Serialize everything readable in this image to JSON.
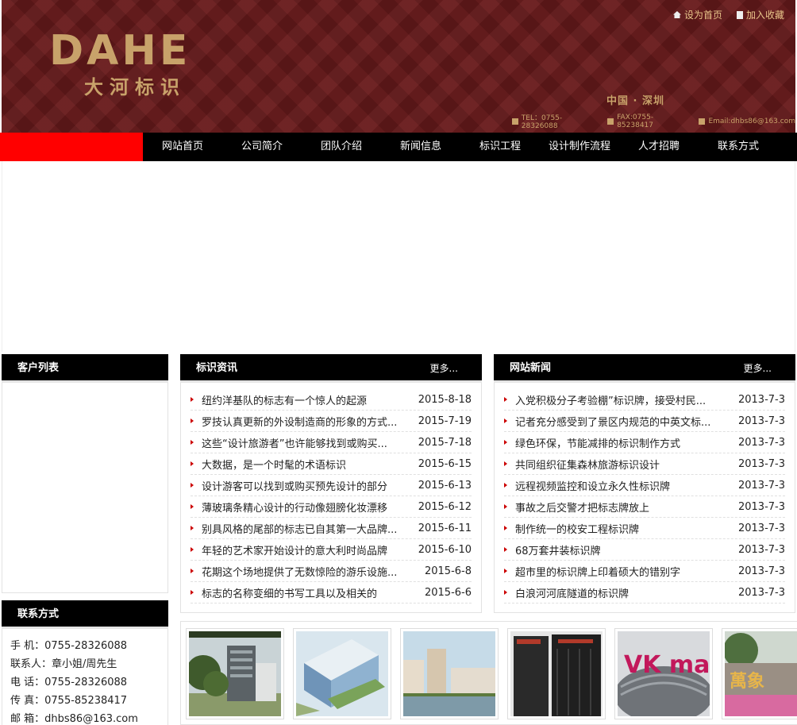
{
  "header": {
    "logo_en": "DAHE",
    "logo_cn": "大河标识",
    "set_home": "设为首页",
    "add_fav": "加入收藏",
    "region": "中国 · 深圳",
    "tel": "TEL：0755-28326088",
    "fax": "FAX:0755-85238417",
    "email": "Email:dhbs86@163.com"
  },
  "nav": {
    "items": [
      "网站首页",
      "公司简介",
      "团队介绍",
      "新闻信息",
      "标识工程",
      "设计制作流程",
      "人才招聘",
      "联系方式"
    ]
  },
  "clients": {
    "title": "客户列表"
  },
  "contact": {
    "title": "联系方式",
    "lines": [
      "手 机：0755-28326088",
      "联系人：章小姐/周先生",
      "电 话：0755-28326088",
      "传 真：0755-85238417",
      "邮 箱：dhbs86@163.com"
    ]
  },
  "sign_news": {
    "title": "标识资讯",
    "more": "更多...",
    "items": [
      {
        "title": "纽约洋基队的标志有一个惊人的起源",
        "date": "2015-8-18"
      },
      {
        "title": "罗技认真更新的外设制造商的形象的方式...",
        "date": "2015-7-19"
      },
      {
        "title": "这些“设计旅游者”也许能够找到或购买...",
        "date": "2015-7-18"
      },
      {
        "title": "大数据，是一个时髦的术语标识",
        "date": "2015-6-15"
      },
      {
        "title": "设计游客可以找到或购买预先设计的部分",
        "date": "2015-6-13"
      },
      {
        "title": "薄玻璃条精心设计的行动像翅膀化妆漂移",
        "date": "2015-6-12"
      },
      {
        "title": "别具风格的尾部的标志已自其第一大品牌...",
        "date": "2015-6-11"
      },
      {
        "title": "年轻的艺术家开始设计的意大利时尚品牌",
        "date": "2015-6-10"
      },
      {
        "title": "花期这个场地提供了无数惊险的游乐设施...",
        "date": "2015-6-8"
      },
      {
        "title": "标志的名称变细的书写工具以及相关的",
        "date": "2015-6-6"
      }
    ]
  },
  "site_news": {
    "title": "网站新闻",
    "more": "更多...",
    "items": [
      {
        "title": "入党积极分子考验棚”标识牌，接受村民...",
        "date": "2013-7-3"
      },
      {
        "title": "记者充分感受到了景区内规范的中英文标...",
        "date": "2013-7-3"
      },
      {
        "title": "绿色环保，节能减排的标识制作方式",
        "date": "2013-7-3"
      },
      {
        "title": "共同组织征集森林旅游标识设计",
        "date": "2013-7-3"
      },
      {
        "title": "远程视频监控和设立永久性标识牌",
        "date": "2013-7-3"
      },
      {
        "title": "事故之后交警才把标志牌放上",
        "date": "2013-7-3"
      },
      {
        "title": "制作统一的校安工程标识牌",
        "date": "2013-7-3"
      },
      {
        "title": "68万套井装标识牌",
        "date": "2013-7-3"
      },
      {
        "title": "超市里的标识牌上印着硕大的错别字",
        "date": "2013-7-3"
      },
      {
        "title": "白浪河河底隧道的标识牌",
        "date": "2013-7-3"
      }
    ]
  },
  "gallery": {
    "thumb_text": [
      "VK mall",
      "萬象"
    ]
  }
}
